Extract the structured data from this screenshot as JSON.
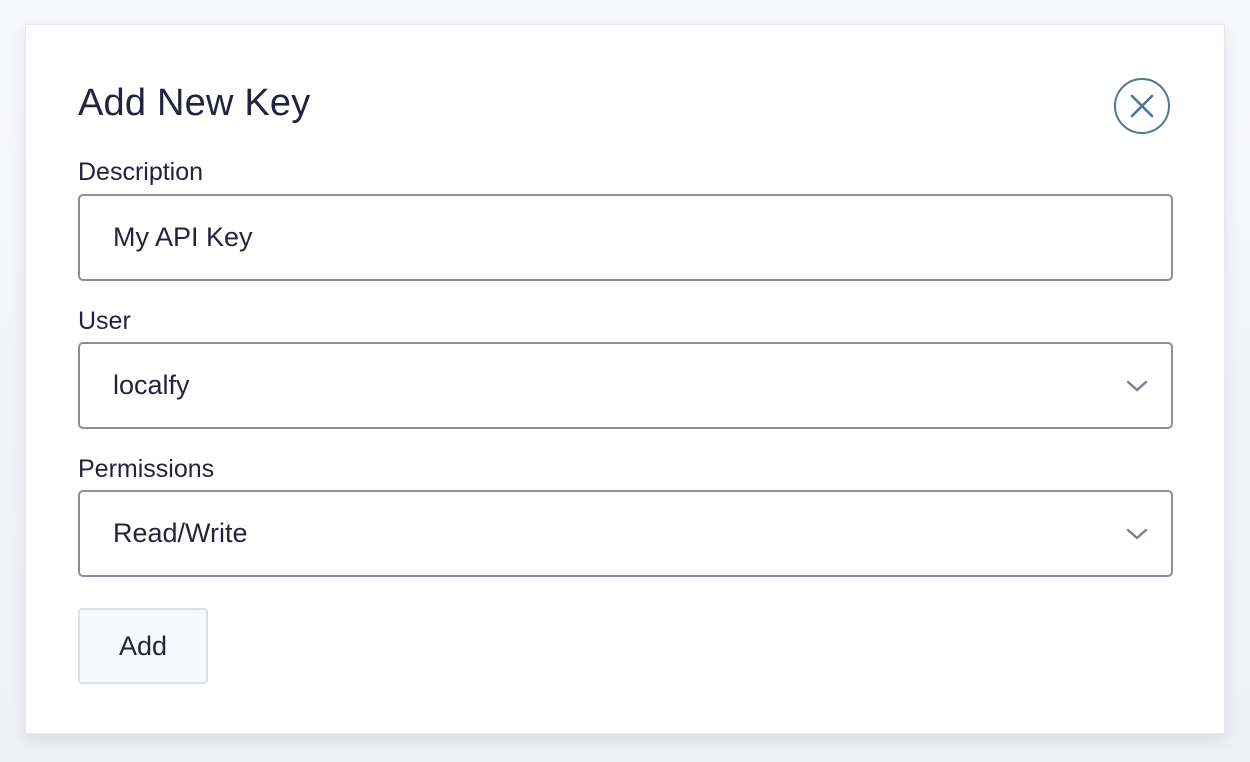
{
  "dialog": {
    "title": "Add New Key",
    "close_icon": "close-icon"
  },
  "description": {
    "label": "Description",
    "value": "My API Key"
  },
  "user": {
    "label": "User",
    "selected": "localfy",
    "icon": "chevron-down-icon"
  },
  "permissions": {
    "label": "Permissions",
    "selected": "Read/Write",
    "icon": "chevron-down-icon"
  },
  "actions": {
    "add_label": "Add"
  },
  "colors": {
    "text": "#23233f",
    "accent": "#4f7696",
    "border": "#8b8ca3",
    "background": "#f5f6f9"
  }
}
